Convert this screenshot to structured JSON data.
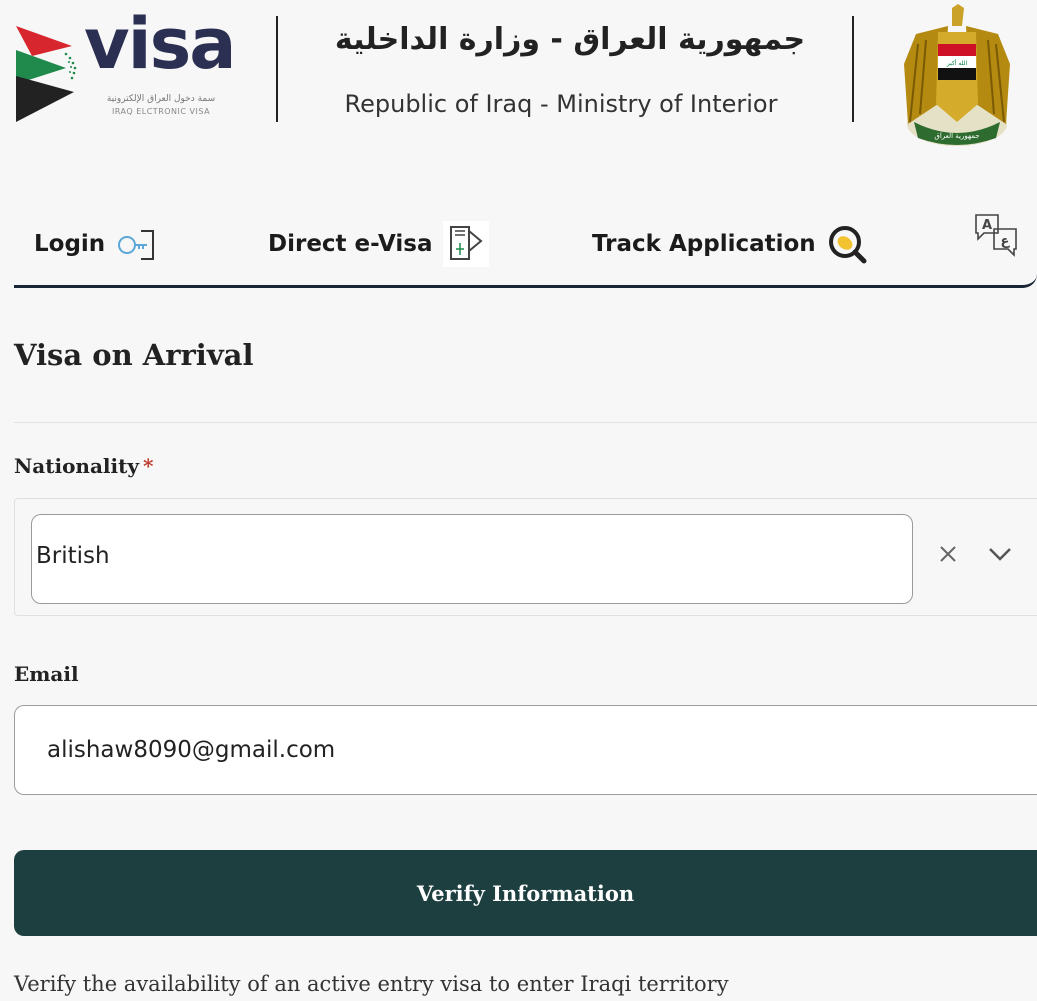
{
  "header": {
    "logo_word": "visa",
    "logo_sub_ar": "سمة دخول العراق الإلكترونية",
    "logo_sub_en": "IRAQ ELCTRONIC VISA",
    "ministry_ar": "جمهورية العراق - وزارة الداخلية",
    "ministry_en": "Republic of Iraq  - Ministry of Interior",
    "emblem_text_top": "الله أكبر",
    "emblem_text_bottom": "جمهورية العراق"
  },
  "nav": {
    "items": [
      {
        "label": "Login",
        "icon": "key-icon"
      },
      {
        "label": "Direct e-Visa",
        "icon": "passport-icon"
      },
      {
        "label": "Track Application",
        "icon": "magnifier-icon"
      }
    ],
    "language_icon": "translate-icon"
  },
  "form": {
    "title": "Visa on Arrival",
    "nationality_label": "Nationality",
    "required_mark": "*",
    "nationality_value": "British",
    "email_label": "Email",
    "email_value": "alishaw8090@gmail.com",
    "verify_label": "Verify Information",
    "note": "Verify the availability of an active entry visa to enter Iraqi territory"
  },
  "colors": {
    "brand_dark": "#2b2f52",
    "button": "#1e3f40",
    "nav_border": "#1a2536",
    "required": "#c0392b",
    "flag_red": "#ce1126",
    "flag_green": "#007a3d"
  }
}
